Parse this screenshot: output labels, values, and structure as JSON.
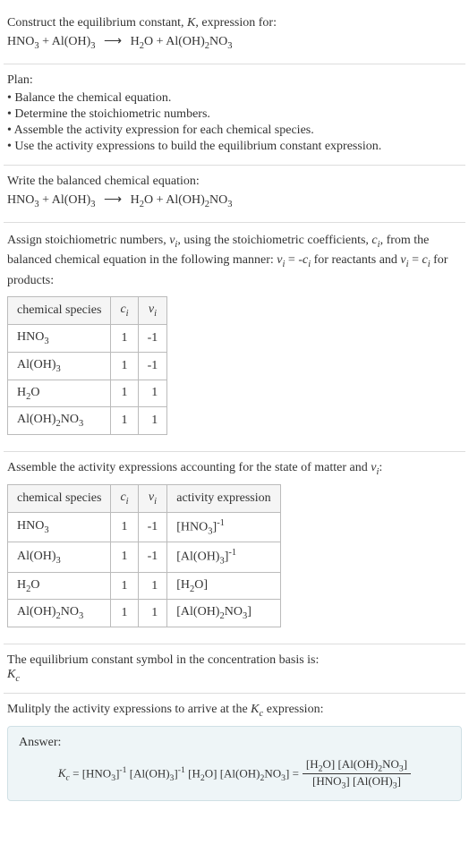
{
  "intro": {
    "line1": "Construct the equilibrium constant, K, expression for:",
    "equation_lhs": "HNO₃ + Al(OH)₃",
    "arrow": "⟶",
    "equation_rhs": "H₂O + Al(OH)₂NO₃"
  },
  "plan": {
    "title": "Plan:",
    "items": [
      "• Balance the chemical equation.",
      "• Determine the stoichiometric numbers.",
      "• Assemble the activity expression for each chemical species.",
      "• Use the activity expressions to build the equilibrium constant expression."
    ]
  },
  "balanced": {
    "title": "Write the balanced chemical equation:",
    "equation_lhs": "HNO₃ + Al(OH)₃",
    "arrow": "⟶",
    "equation_rhs": "H₂O + Al(OH)₂NO₃"
  },
  "stoich": {
    "intro1": "Assign stoichiometric numbers, νᵢ, using the stoichiometric coefficients, cᵢ, from the balanced chemical equation in the following manner: νᵢ = -cᵢ for reactants and νᵢ = cᵢ for products:",
    "headers": {
      "species": "chemical species",
      "ci": "cᵢ",
      "vi": "νᵢ"
    },
    "rows": [
      {
        "species": "HNO₃",
        "ci": "1",
        "vi": "-1"
      },
      {
        "species": "Al(OH)₃",
        "ci": "1",
        "vi": "-1"
      },
      {
        "species": "H₂O",
        "ci": "1",
        "vi": "1"
      },
      {
        "species": "Al(OH)₂NO₃",
        "ci": "1",
        "vi": "1"
      }
    ]
  },
  "activity": {
    "intro": "Assemble the activity expressions accounting for the state of matter and νᵢ:",
    "headers": {
      "species": "chemical species",
      "ci": "cᵢ",
      "vi": "νᵢ",
      "expr": "activity expression"
    },
    "rows": [
      {
        "species": "HNO₃",
        "ci": "1",
        "vi": "-1",
        "expr": "[HNO₃]⁻¹"
      },
      {
        "species": "Al(OH)₃",
        "ci": "1",
        "vi": "-1",
        "expr": "[Al(OH)₃]⁻¹"
      },
      {
        "species": "H₂O",
        "ci": "1",
        "vi": "1",
        "expr": "[H₂O]"
      },
      {
        "species": "Al(OH)₂NO₃",
        "ci": "1",
        "vi": "1",
        "expr": "[Al(OH)₂NO₃]"
      }
    ]
  },
  "symbol": {
    "line1": "The equilibrium constant symbol in the concentration basis is:",
    "kc": "K𝒸"
  },
  "multiply": {
    "intro": "Mulitply the activity expressions to arrive at the K𝒸 expression:"
  },
  "answer": {
    "label": "Answer:",
    "kc": "K𝒸 =",
    "terms": "[HNO₃]⁻¹ [Al(OH)₃]⁻¹ [H₂O] [Al(OH)₂NO₃] =",
    "num": "[H₂O] [Al(OH)₂NO₃]",
    "den": "[HNO₃] [Al(OH)₃]"
  }
}
